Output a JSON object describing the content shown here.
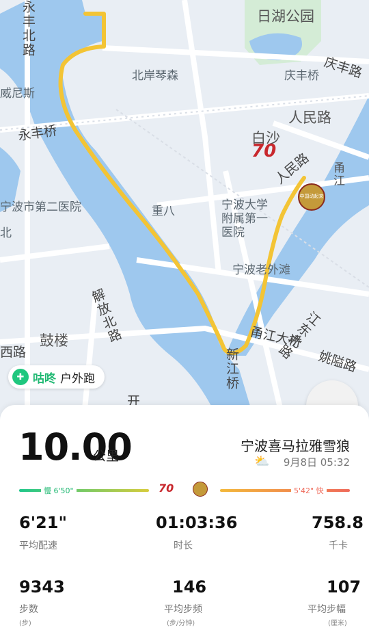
{
  "map": {
    "labels": {
      "ri_hu_park": "日湖公园",
      "yong_feng_bei_lu": "永丰北路",
      "bei_an_qin_sen": "北岸琴森",
      "qing_feng_qiao": "庆丰桥",
      "qing_feng_lu": "庆丰路",
      "wei_ni_si": "威尼斯",
      "ren_min_lu": "人民路",
      "bai_sha": "白沙",
      "yong_feng_qiao": "永丰桥",
      "ren_min_lu_2": "人民路",
      "yong_jiang": "甬江",
      "hospital_2": "宁波市第二医院",
      "chong_ba": "重八",
      "hospital_univ": "宁波大学附属第一医院",
      "old_bund": "宁波老外滩",
      "jie_fang_bei_lu": "解放北路",
      "gu_lou": "鼓楼",
      "yong_jiang_bridge": "甬江大桥",
      "jiang_dong_bei_lu": "江东北路",
      "yao_long_lu": "姚隘路",
      "xi_lu": "西路",
      "xin_jiang_qiao": "新江桥",
      "kai": "开",
      "bei": "北"
    },
    "stamp_70": "70",
    "stamp_logo": "中国动起来"
  },
  "badge": {
    "brand": "咕咚",
    "type": "户外跑"
  },
  "summary": {
    "distance": "10.00",
    "unit": "公里",
    "runner": "宁波喜马拉雅雪狼",
    "date": "9月8日 05:32"
  },
  "pace_bar": {
    "slow": "慢 6'50\"",
    "fast": "5'42\" 快"
  },
  "stats": {
    "pace": {
      "value": "6'21\"",
      "label": "平均配速"
    },
    "duration": {
      "value": "01:03:36",
      "label": "时长"
    },
    "calories": {
      "value": "758.8",
      "label": "千卡"
    },
    "steps": {
      "value": "9343",
      "label": "步数",
      "unit": "(步)"
    },
    "cadence": {
      "value": "146",
      "label": "平均步频",
      "unit": "(步/分钟)"
    },
    "stride": {
      "value": "107",
      "label": "平均步幅",
      "unit": "(厘米)"
    }
  },
  "colors": {
    "river": "#9ec8ee",
    "track": "#f3c435",
    "brand": "#1fb872"
  }
}
